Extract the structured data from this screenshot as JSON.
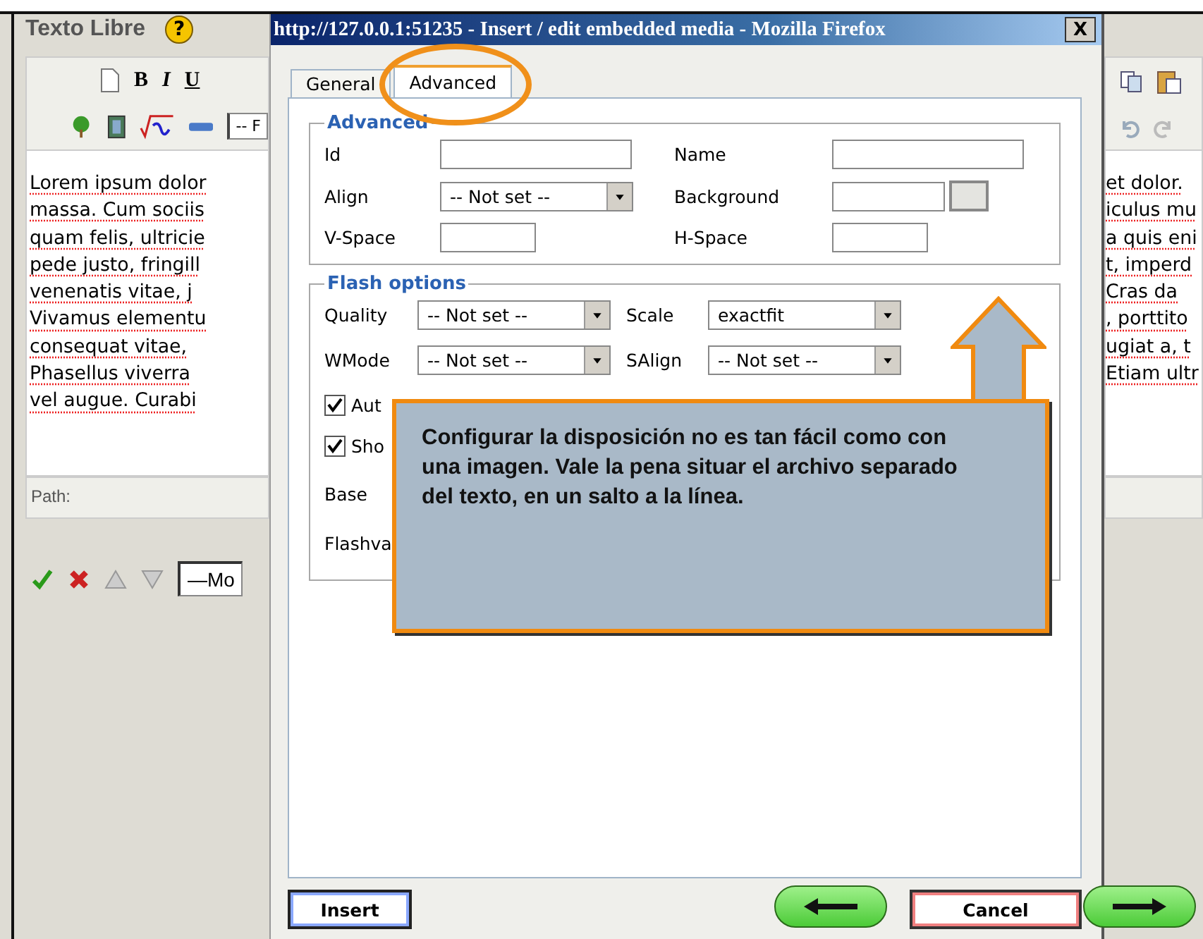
{
  "editor": {
    "title": "Texto Libre",
    "help": "?",
    "toolbar": {
      "bold": "B",
      "italic": "I",
      "underline": "U",
      "format_select": "-- F"
    },
    "left_lines": [
      "Lorem ipsum dolor",
      "massa. Cum sociis",
      "quam felis, ultricie",
      "pede justo, fringill",
      "venenatis vitae, j",
      "Vivamus elementu",
      "consequat vitae,",
      "Phasellus viverra",
      "vel augue. Curabi"
    ],
    "right_lines": [
      "et dolor.",
      "iculus mu",
      "a quis eni",
      "t, imperd",
      "Cras da",
      ", porttito",
      "ugiat a, t",
      "Etiam ultr"
    ],
    "path_label": "Path:",
    "style_select": "—Mo"
  },
  "dialog": {
    "title": "http://127.0.0.1:51235 - Insert / edit embedded media - Mozilla Firefox",
    "close": "X",
    "tabs": [
      {
        "label": "General",
        "selected": false
      },
      {
        "label": "Advanced",
        "selected": true
      }
    ],
    "advanced": {
      "legend": "Advanced",
      "fields": [
        {
          "label": "Id",
          "kind": "text"
        },
        {
          "label": "Name",
          "kind": "text"
        },
        {
          "label": "Align",
          "kind": "select",
          "value": "-- Not set --"
        },
        {
          "label": "Background",
          "kind": "color"
        },
        {
          "label": "V-Space",
          "kind": "short"
        },
        {
          "label": "H-Space",
          "kind": "short"
        }
      ]
    },
    "flash": {
      "legend": "Flash options",
      "fields": [
        {
          "label": "Quality",
          "kind": "select",
          "value": "-- Not set --"
        },
        {
          "label": "Scale",
          "kind": "select",
          "value": "exactfit"
        },
        {
          "label": "WMode",
          "kind": "select",
          "value": "-- Not set --"
        },
        {
          "label": "SAlign",
          "kind": "select",
          "value": "-- Not set --"
        }
      ],
      "checkboxes": [
        {
          "label": "Aut",
          "checked": true
        },
        {
          "label": "Sho",
          "checked": true
        }
      ],
      "labels": [
        "Base",
        "Flashva"
      ]
    },
    "insert": "Insert",
    "cancel": "Cancel"
  },
  "callout": {
    "text": "Configurar la disposición no es tan fácil como con una imagen. Vale la pena situar el archivo separado del texto, en un salto a la línea."
  }
}
